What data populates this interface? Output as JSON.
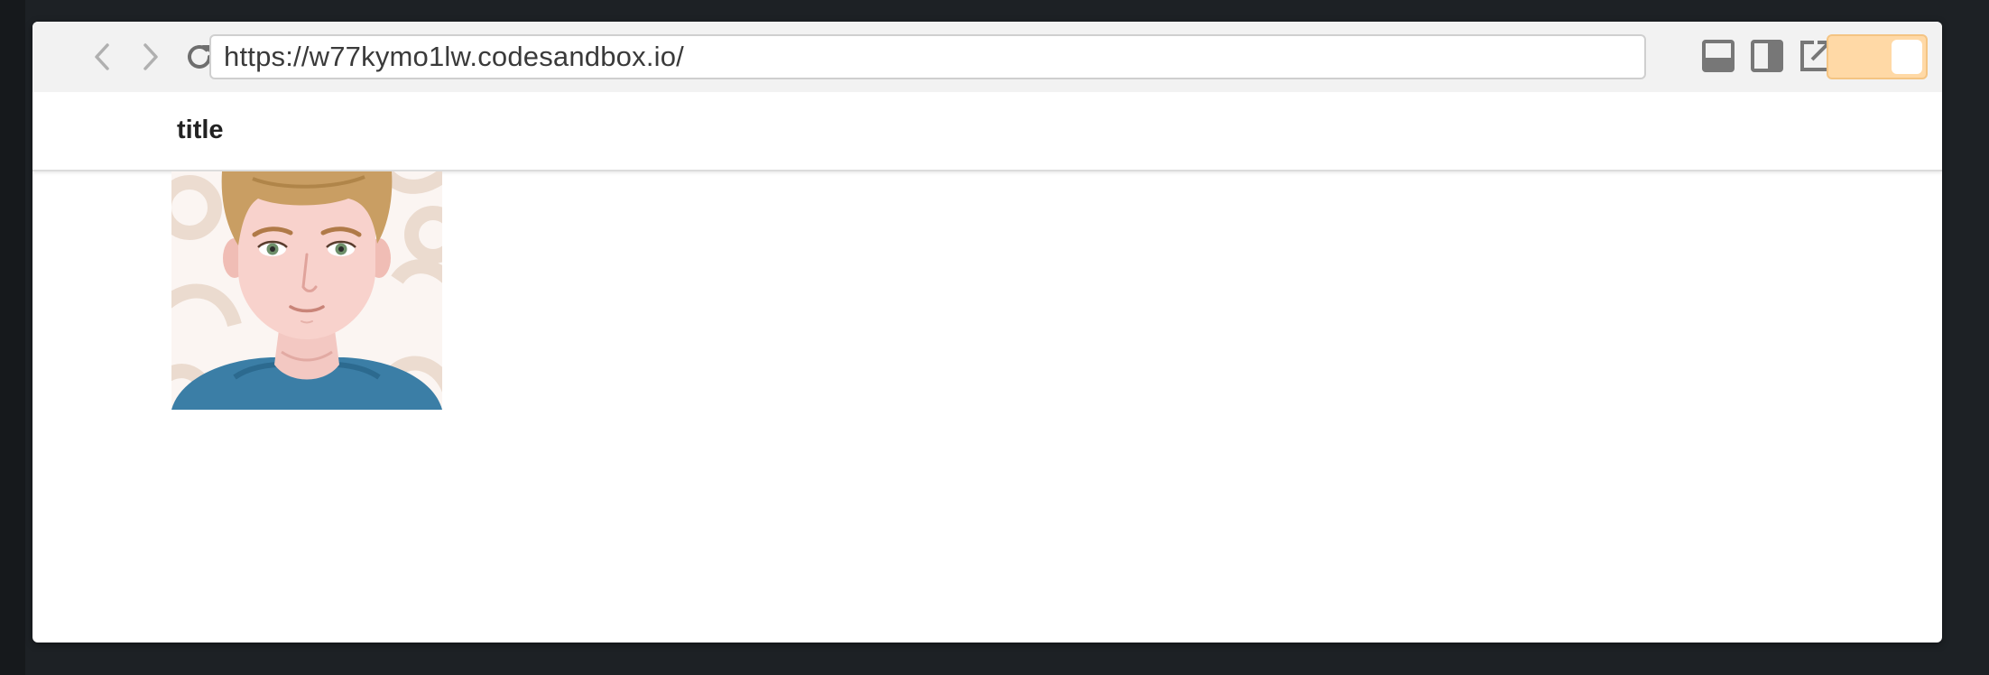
{
  "browser": {
    "url": "https://w77kymo1lw.codesandbox.io/",
    "icons": {
      "back": "chevron-left-icon",
      "forward": "chevron-right-icon",
      "reload": "reload-icon",
      "layout_bottom": "layout-bottom-panel-icon",
      "layout_side": "layout-side-panel-icon",
      "open_external": "open-external-icon",
      "toggle": "toggle-switch"
    },
    "toggle": {
      "on": true
    },
    "colors": {
      "toolbar_bg": "#f2f2f2",
      "toggle_bg": "#ffd9a6",
      "page_bg": "#1d2125"
    }
  },
  "app": {
    "title": "title"
  },
  "avatar": {
    "icon": "avatar-illustration"
  }
}
